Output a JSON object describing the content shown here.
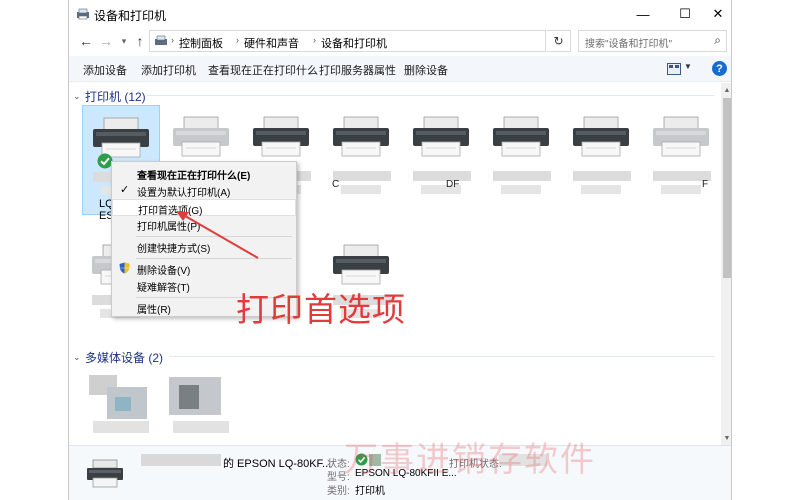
{
  "window": {
    "title": "设备和打印机",
    "minimize_glyph": "—",
    "maximize_glyph": "☐",
    "close_glyph": "✕"
  },
  "address": {
    "breadcrumbs": [
      "控制面板",
      "硬件和声音",
      "设备和打印机"
    ],
    "search_placeholder": "搜索\"设备和打印机\""
  },
  "toolbar": {
    "commands": [
      "添加设备",
      "添加打印机",
      "查看现在正在打印什么",
      "打印服务器属性",
      "删除设备"
    ],
    "help": "?"
  },
  "groups": {
    "printers": {
      "label": "打印机 (12)"
    },
    "multimedia": {
      "label": "多媒体设备 (2)"
    }
  },
  "selected_device": {
    "label_line1": "LQ",
    "label_line2": "ES"
  },
  "device_fragments": {
    "c_char": "C",
    "df_chars": "DF",
    "f_char": "F"
  },
  "context_menu": {
    "items": [
      {
        "label": "查看现在正在打印什么(E)",
        "bold": true
      },
      {
        "label": "设置为默认打印机(A)",
        "checked": true
      },
      {
        "label": "打印首选项(G)",
        "highlighted": true
      },
      {
        "label": "打印机属性(P)"
      },
      {
        "label": "创建快捷方式(S)"
      },
      {
        "label": "删除设备(V)",
        "shield": true
      },
      {
        "label": "疑难解答(T)"
      },
      {
        "label": "属性(R)"
      }
    ]
  },
  "annotation": {
    "text": "打印首选项",
    "color": "#e23b3b"
  },
  "details": {
    "name": "的 EPSON LQ-80KF...",
    "status_label": "状态:",
    "model_label": "型号:",
    "model_value": "EPSON LQ-80KFII E...",
    "category_label": "类别:",
    "category_value": "打印机",
    "printer_status_label": "打印机状态:"
  },
  "watermark": "万事进销存软件",
  "colors": {
    "accent": "#1a6bd1",
    "selection": "#cce8ff",
    "group_header": "#1e3287"
  }
}
